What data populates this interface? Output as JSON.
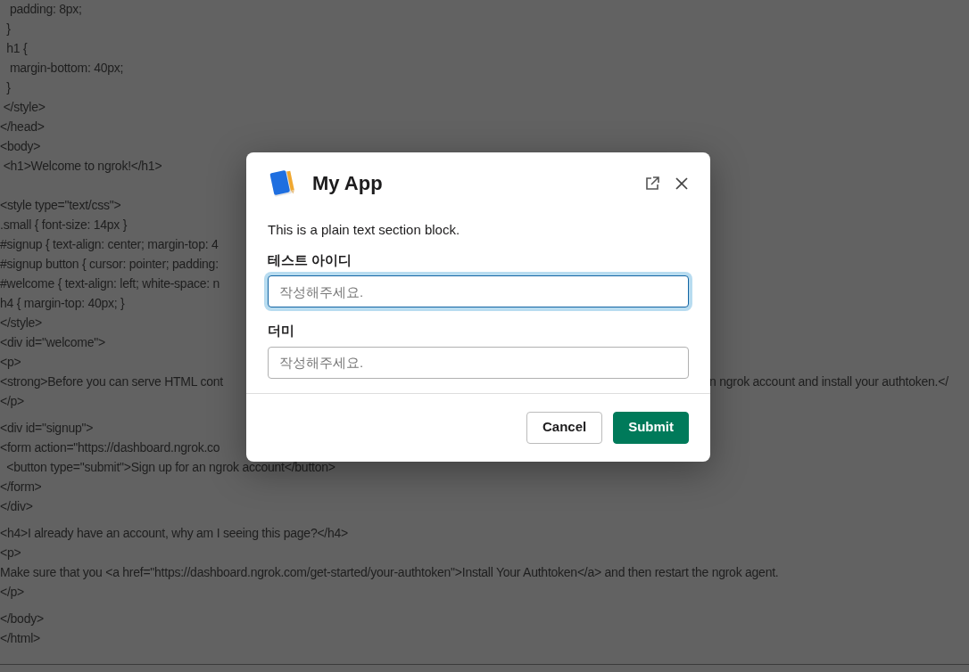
{
  "background_code": {
    "blocks": [
      {
        "lines": [
          {
            "text": "   padding: 8px;"
          },
          {
            "text": "  }"
          },
          {
            "text": "  h1 {"
          },
          {
            "text": "   margin-bottom: 40px;"
          },
          {
            "text": "  }"
          },
          {
            "text": " </style>"
          },
          {
            "text": "</head>"
          },
          {
            "text": "<body>"
          },
          {
            "text": " <h1>Welcome to ngrok!</h1>"
          }
        ]
      },
      {
        "lines": [
          {
            "text": "<style type=\"text/css\">"
          },
          {
            "text": ".small { font-size: 14px }"
          },
          {
            "text": "#signup { text-align: center; margin-top: 4"
          },
          {
            "text": "#signup button { cursor: pointer; padding:"
          },
          {
            "text": "#welcome { text-align: left; white-space: n"
          },
          {
            "text": "h4 { margin-top: 40px; }"
          },
          {
            "text": "</style>"
          },
          {
            "text": "<div id=\"welcome\">"
          },
          {
            "text": "<p>"
          },
          {
            "text": "<strong>Before you can serve HTML cont",
            "text_right": "n ngrok account and install your authtoken.</"
          },
          {
            "text": "</p>"
          }
        ]
      },
      {
        "lines": [
          {
            "text": "<div id=\"signup\">"
          },
          {
            "text": "<form action=\"https://dashboard.ngrok.co"
          },
          {
            "text": "  <button type=\"submit\">Sign up for an ngrok account</button>"
          },
          {
            "text": "</form>"
          },
          {
            "text": "</div>"
          }
        ]
      },
      {
        "lines": [
          {
            "text": "<h4>I already have an account, why am I seeing this page?</h4>"
          },
          {
            "text": "<p>"
          },
          {
            "text": "Make sure that you <a href=\"https://dashboard.ngrok.com/get-started/your-authtoken\">Install Your Authtoken</a> and then restart the ngrok agent."
          },
          {
            "text": "</p>"
          }
        ]
      },
      {
        "lines": [
          {
            "text": "</body>"
          },
          {
            "text": "</html>"
          }
        ]
      }
    ]
  },
  "modal": {
    "title": "My App",
    "text": "This is a plain text section block.",
    "fields": [
      {
        "label": "테스트 아이디",
        "placeholder": "작성해주세요.",
        "focused": true
      },
      {
        "label": "더미",
        "placeholder": "작성해주세요.",
        "focused": false
      }
    ],
    "buttons": [
      {
        "label": "Cancel",
        "kind": "secondary"
      },
      {
        "label": "Submit",
        "kind": "primary"
      }
    ]
  }
}
